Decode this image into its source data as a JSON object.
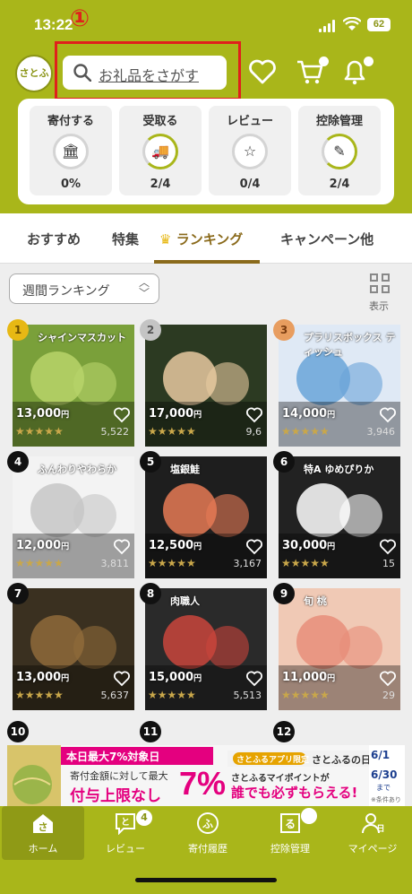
{
  "status": {
    "time": "13:22",
    "battery": "62"
  },
  "annotation": {
    "marker": "①"
  },
  "header": {
    "logo_text": "さとふる",
    "search_placeholder": "お礼品をさがす"
  },
  "menu": [
    {
      "label": "寄付する",
      "value": "0%",
      "icon": "donate-icon"
    },
    {
      "label": "受取る",
      "value": "2/4",
      "icon": "truck-icon"
    },
    {
      "label": "レビュー",
      "value": "0/4",
      "icon": "review-icon"
    },
    {
      "label": "控除管理",
      "value": "2/4",
      "icon": "document-icon"
    }
  ],
  "tabs": [
    "おすすめ",
    "特集",
    "ランキング",
    "キャンペーン他"
  ],
  "active_tab": "ランキング",
  "ranking": {
    "dropdown_label": "週間ランキング",
    "view_label": "表示"
  },
  "products": [
    {
      "rank": "1",
      "price": "13,000",
      "unit": "円",
      "stars": "★★★★★",
      "reviews": "5,522",
      "tag": "シャインマスカット"
    },
    {
      "rank": "2",
      "price": "17,000",
      "unit": "円",
      "stars": "★★★★★",
      "reviews": "9,6",
      "tag": ""
    },
    {
      "rank": "3",
      "price": "14,000",
      "unit": "円",
      "stars": "★★★★★",
      "reviews": "3,946",
      "tag": "プラリスボックス ティッシュ"
    },
    {
      "rank": "4",
      "price": "12,000",
      "unit": "円",
      "stars": "★★★★★",
      "reviews": "3,811",
      "tag": "ふんわりやわらか"
    },
    {
      "rank": "5",
      "price": "12,500",
      "unit": "円",
      "stars": "★★★★★",
      "reviews": "3,167",
      "tag": "塩銀鮭"
    },
    {
      "rank": "6",
      "price": "30,000",
      "unit": "円",
      "stars": "★★★★★",
      "reviews": "15",
      "tag": "特A ゆめぴりか"
    },
    {
      "rank": "7",
      "price": "13,000",
      "unit": "円",
      "stars": "★★★★★",
      "reviews": "5,637",
      "tag": ""
    },
    {
      "rank": "8",
      "price": "15,000",
      "unit": "円",
      "stars": "★★★★★",
      "reviews": "5,513",
      "tag": "肉職人"
    },
    {
      "rank": "9",
      "price": "11,000",
      "unit": "円",
      "stars": "★★★★★",
      "reviews": "29",
      "tag": "旬 桃"
    }
  ],
  "next_ranks": [
    "10",
    "11",
    "12"
  ],
  "banner": {
    "headline": "本日最大7%対象日",
    "sub": "寄付金額に対して最大",
    "big_label": "付与上限なし",
    "big_pct": "7%",
    "app_only": "さとふるアプリ限定",
    "day": "さとふるの日",
    "point_text": "さとふるマイポイントが",
    "everyone": "誰でも必ずもらえる!",
    "date_from": "6/1",
    "date_to": "6/30",
    "date_suffix": "まで",
    "note": "※条件あり"
  },
  "tabbar": [
    {
      "label": "ホーム",
      "icon": "home-icon"
    },
    {
      "label": "レビュー",
      "icon": "review-icon",
      "badge": "4"
    },
    {
      "label": "寄付履歴",
      "icon": "history-icon"
    },
    {
      "label": "控除管理",
      "icon": "deduction-icon"
    },
    {
      "label": "マイページ",
      "icon": "mypage-icon"
    }
  ],
  "colors": {
    "brand": "#a9b61a",
    "accent": "#8a6a1b",
    "annotation": "#e0201c"
  }
}
